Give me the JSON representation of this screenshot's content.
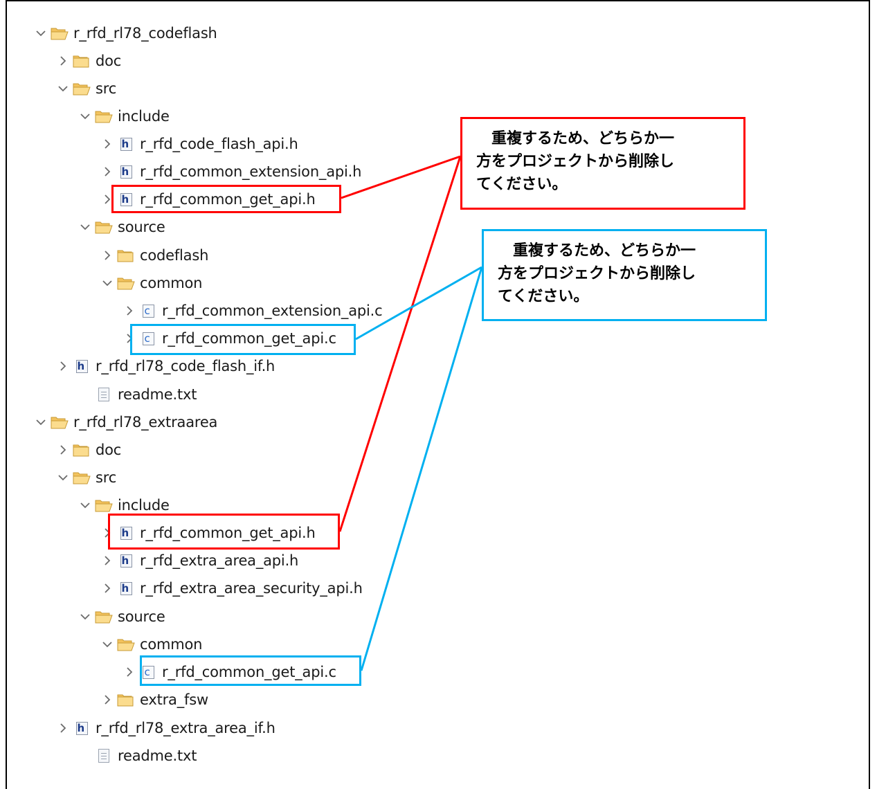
{
  "tree": [
    {
      "label": "r_rfd_rl78_codeflash",
      "icon": "folder-icon",
      "expanded": true
    },
    {
      "label": "doc",
      "icon": "folder-icon",
      "expanded": false
    },
    {
      "label": "src",
      "icon": "folder-icon",
      "expanded": true
    },
    {
      "label": "include",
      "icon": "folder-icon",
      "expanded": true
    },
    {
      "label": "r_rfd_code_flash_api.h",
      "icon": "h-file-icon",
      "expanded": false
    },
    {
      "label": "r_rfd_common_extension_api.h",
      "icon": "h-file-icon",
      "expanded": false
    },
    {
      "label": "r_rfd_common_get_api.h",
      "icon": "h-file-icon",
      "expanded": false
    },
    {
      "label": "source",
      "icon": "folder-icon",
      "expanded": true
    },
    {
      "label": "codeflash",
      "icon": "folder-icon",
      "expanded": false
    },
    {
      "label": "common",
      "icon": "folder-icon",
      "expanded": true
    },
    {
      "label": "r_rfd_common_extension_api.c",
      "icon": "c-file-icon",
      "expanded": false
    },
    {
      "label": "r_rfd_common_get_api.c",
      "icon": "c-file-icon",
      "expanded": false
    },
    {
      "label": "r_rfd_rl78_code_flash_if.h",
      "icon": "h-file-icon",
      "expanded": false
    },
    {
      "label": "readme.txt",
      "icon": "text-file-icon",
      "expanded": null
    },
    {
      "label": "r_rfd_rl78_extraarea",
      "icon": "folder-icon",
      "expanded": true
    },
    {
      "label": "doc",
      "icon": "folder-icon",
      "expanded": false
    },
    {
      "label": "src",
      "icon": "folder-icon",
      "expanded": true
    },
    {
      "label": "include",
      "icon": "folder-icon",
      "expanded": true
    },
    {
      "label": "r_rfd_common_get_api.h",
      "icon": "h-file-icon",
      "expanded": false
    },
    {
      "label": "r_rfd_extra_area_api.h",
      "icon": "h-file-icon",
      "expanded": false
    },
    {
      "label": "r_rfd_extra_area_security_api.h",
      "icon": "h-file-icon",
      "expanded": false
    },
    {
      "label": "source",
      "icon": "folder-icon",
      "expanded": true
    },
    {
      "label": "common",
      "icon": "folder-icon",
      "expanded": true
    },
    {
      "label": "r_rfd_common_get_api.c",
      "icon": "c-file-icon",
      "expanded": false
    },
    {
      "label": "extra_fsw",
      "icon": "folder-icon",
      "expanded": false
    },
    {
      "label": "r_rfd_rl78_extra_area_if.h",
      "icon": "h-file-icon",
      "expanded": false
    },
    {
      "label": "readme.txt",
      "icon": "text-file-icon",
      "expanded": null
    }
  ],
  "callouts": {
    "red": {
      "text": "　重複するため、どちらか一\n方をプロジェクトから削除し\nてください。",
      "color": "#ff0000"
    },
    "blue": {
      "text": "　重複するため、どちらか一\n方をプロジェクトから削除し\nてください。",
      "color": "#00b0f0"
    }
  },
  "colors": {
    "folder": "#f3c35e",
    "folder_stroke": "#c79a34",
    "chevron": "#6b6b6b"
  }
}
